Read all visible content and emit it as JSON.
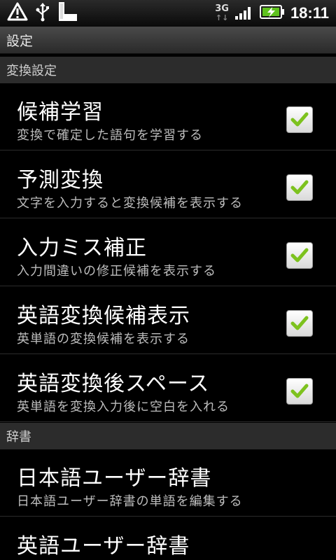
{
  "status_bar": {
    "network": "3G",
    "time": "18:11",
    "icons": [
      "alert-icon",
      "usb-icon",
      "sd-card-icon",
      "signal-icon",
      "battery-charging-icon"
    ]
  },
  "title": "設定",
  "sections": [
    {
      "header": "変換設定",
      "items": [
        {
          "title": "候補学習",
          "summary": "変換で確定した語句を学習する",
          "checked": true
        },
        {
          "title": "予測変換",
          "summary": "文字を入力すると変換候補を表示する",
          "checked": true
        },
        {
          "title": "入力ミス補正",
          "summary": "入力間違いの修正候補を表示する",
          "checked": true
        },
        {
          "title": "英語変換候補表示",
          "summary": "英単語の変換候補を表示する",
          "checked": true
        },
        {
          "title": "英語変換後スペース",
          "summary": "英単語を変換入力後に空白を入れる",
          "checked": true
        }
      ]
    },
    {
      "header": "辞書",
      "items": [
        {
          "title": "日本語ユーザー辞書",
          "summary": "日本語ユーザー辞書の単語を編集する"
        },
        {
          "title": "英語ユーザー辞書",
          "summary": ""
        }
      ]
    }
  ],
  "colors": {
    "check": "#7dc21e",
    "section_bg": "#2c2c2c"
  }
}
